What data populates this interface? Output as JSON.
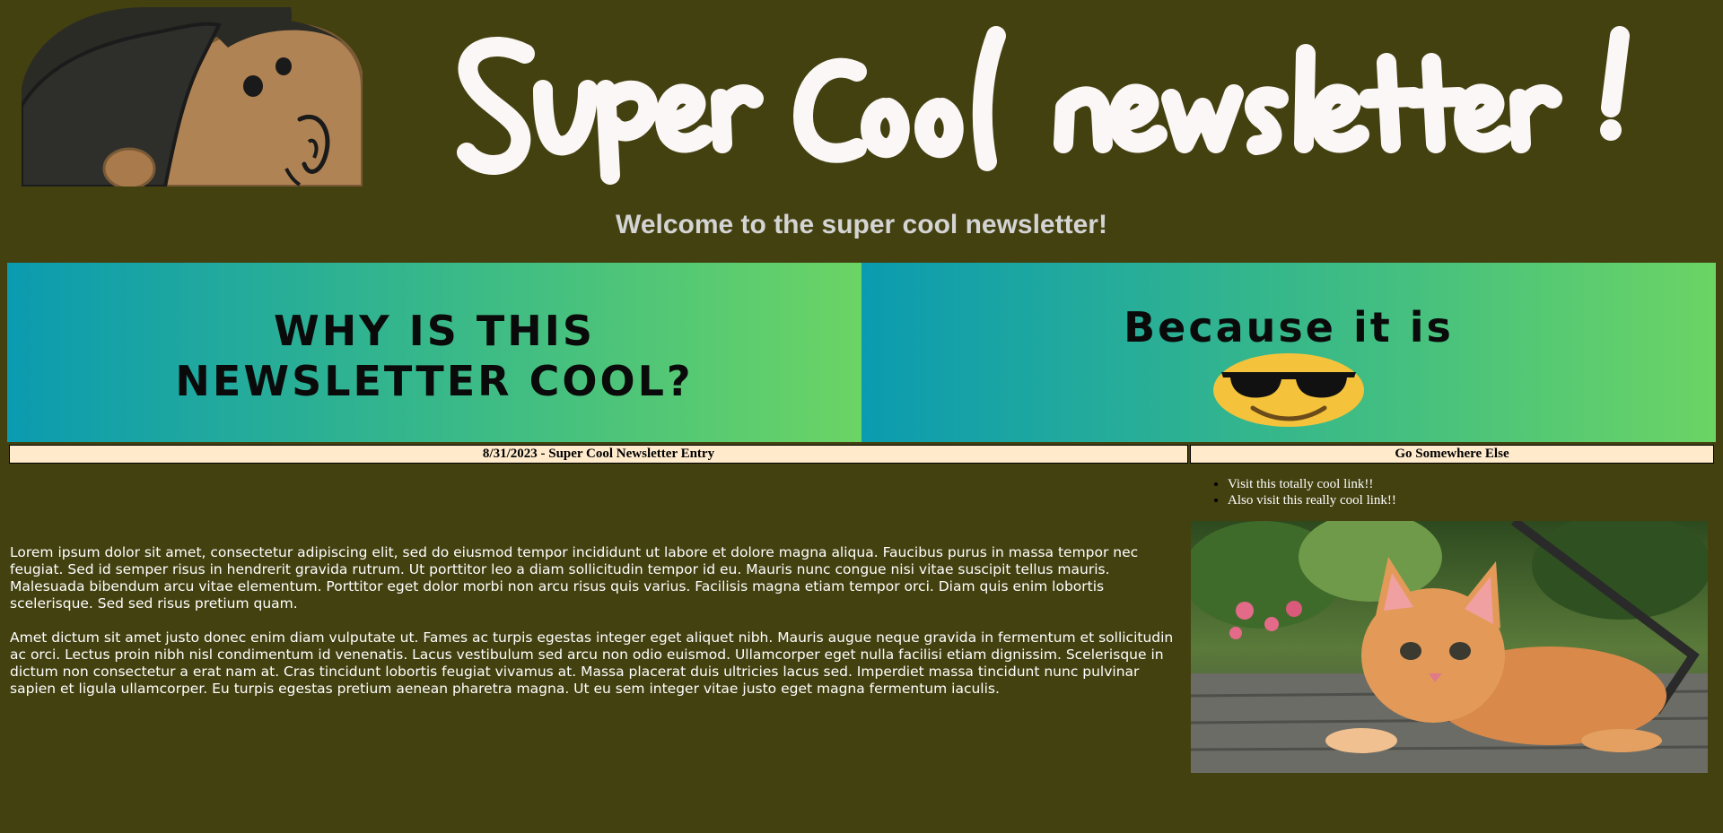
{
  "header": {
    "title_art": "Super Cool newsletter!",
    "welcome": "Welcome to the super cool newsletter!"
  },
  "banners": {
    "left_line1": "WHY IS THIS",
    "left_line2": "NEWSLETTER COOL?",
    "right_line1": "Because it is"
  },
  "entry": {
    "header": "8/31/2023 - Super Cool Newsletter Entry",
    "paragraphs": [
      "Lorem ipsum dolor sit amet, consectetur adipiscing elit, sed do eiusmod tempor incididunt ut labore et dolore magna aliqua. Faucibus purus in massa tempor nec feugiat. Sed id semper risus in hendrerit gravida rutrum. Ut porttitor leo a diam sollicitudin tempor id eu. Mauris nunc congue nisi vitae suscipit tellus mauris. Malesuada bibendum arcu vitae elementum. Porttitor eget dolor morbi non arcu risus quis varius. Facilisis magna etiam tempor orci. Diam quis enim lobortis scelerisque. Sed sed risus pretium quam.",
      "Amet dictum sit amet justo donec enim diam vulputate ut. Fames ac turpis egestas integer eget aliquet nibh. Mauris augue neque gravida in fermentum et sollicitudin ac orci. Lectus proin nibh nisl condimentum id venenatis. Lacus vestibulum sed arcu non odio euismod. Ullamcorper eget nulla facilisi etiam dignissim. Scelerisque in dictum non consectetur a erat nam at. Cras tincidunt lobortis feugiat vivamus at. Massa placerat duis ultricies lacus sed. Imperdiet massa tincidunt nunc pulvinar sapien et ligula ullamcorper. Eu turpis egestas pretium aenean pharetra magna. Ut eu sem integer vitae justo eget magna fermentum iaculis."
    ]
  },
  "sidebar": {
    "header": "Go Somewhere Else",
    "links": [
      "Visit this totally cool link!!",
      "Also visit this really cool link!!"
    ]
  },
  "colors": {
    "page_background": "#434110",
    "table_header_background": "#ffeacc",
    "banner_gradient_start": "#0b9bb0",
    "banner_gradient_end": "#6bd464"
  },
  "icons": {
    "avatar": "cartoon-face-avatar",
    "emoji": "sunglasses-emoji",
    "photo": "kitten-photo"
  }
}
